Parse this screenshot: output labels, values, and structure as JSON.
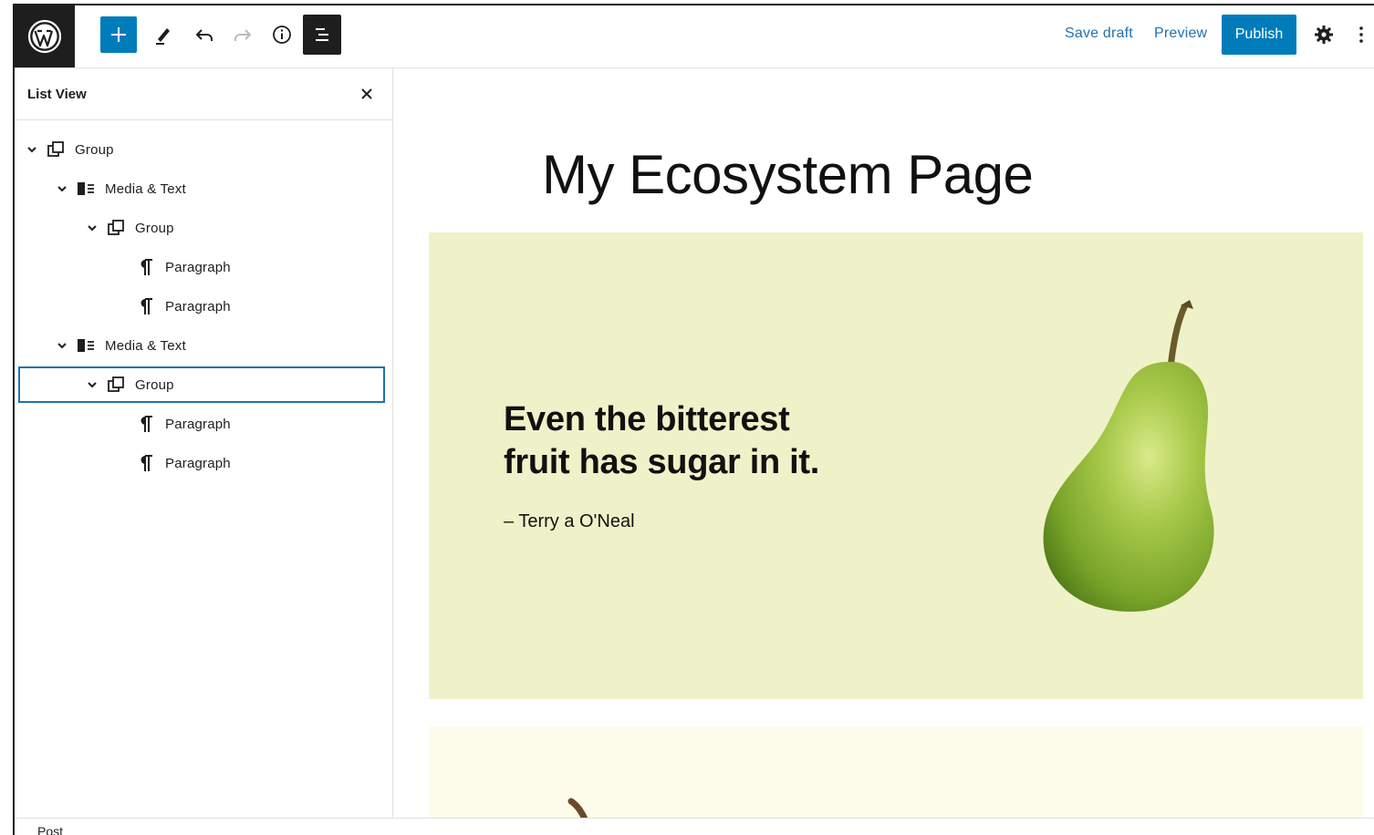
{
  "toolbar": {
    "save_draft": "Save draft",
    "preview": "Preview",
    "publish": "Publish",
    "icons": {
      "logo": "wordpress-logo-icon",
      "inserter": "plus-icon",
      "tools": "pencil-icon",
      "undo": "undo-icon",
      "redo": "redo-icon",
      "details": "info-icon",
      "list_view": "list-view-icon",
      "settings": "gear-icon",
      "options": "more-vertical-icon"
    }
  },
  "list_view": {
    "title": "List View",
    "items": [
      {
        "label": "Group",
        "level": 0,
        "icon": "group-icon",
        "expandable": true
      },
      {
        "label": "Media & Text",
        "level": 1,
        "icon": "media-text-icon",
        "expandable": true
      },
      {
        "label": "Group",
        "level": 2,
        "icon": "group-icon",
        "expandable": true
      },
      {
        "label": "Paragraph",
        "level": 3,
        "icon": "paragraph-icon",
        "expandable": false
      },
      {
        "label": "Paragraph",
        "level": 3,
        "icon": "paragraph-icon",
        "expandable": false
      },
      {
        "label": "Media & Text",
        "level": 1,
        "icon": "media-text-icon",
        "expandable": true
      },
      {
        "label": "Group",
        "level": 2,
        "icon": "group-icon",
        "expandable": true,
        "selected": true
      },
      {
        "label": "Paragraph",
        "level": 3,
        "icon": "paragraph-icon",
        "expandable": false
      },
      {
        "label": "Paragraph",
        "level": 3,
        "icon": "paragraph-icon",
        "expandable": false
      }
    ]
  },
  "canvas": {
    "page_title": "My Ecosystem Page",
    "block1": {
      "quote": "Even the bitterest fruit has sugar in it.",
      "author": "– Terry a O'Neal",
      "background": "#eff2c8",
      "image": "pear-image"
    },
    "block2": {
      "background": "#fdfbe9"
    }
  },
  "footer": {
    "breadcrumb": "Post"
  },
  "colors": {
    "accent": "#007cba",
    "link": "#2271b1",
    "dark": "#1e1e1e"
  }
}
